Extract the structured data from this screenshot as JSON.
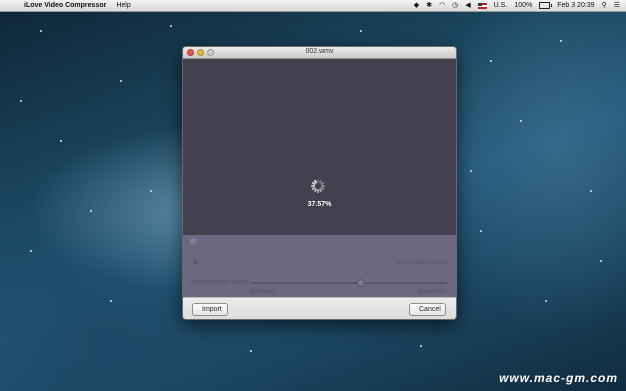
{
  "menubar": {
    "app_name": "iLove Video Compressor",
    "menu_help": "Help",
    "input_source": "U.S.",
    "battery": "100%",
    "clock": "Feb 3  20:39"
  },
  "window": {
    "title": "002.wmv",
    "progress_label": "37.57%",
    "progress": 0.3757,
    "timecode": "00:00:00/00:02:16",
    "compression_label": "Compression Ratio",
    "slider_min_label": "Minimum",
    "slider_max_label": "Maximum",
    "slider_value": 0.56,
    "import_label": "Import",
    "cancel_label": "Cancel"
  },
  "watermark": "www.mac-gm.com",
  "colors": {
    "video_bg": "#45404f",
    "controls_bg": "#6d6780",
    "close": "#e05a4e",
    "minimize": "#e8b74a"
  }
}
